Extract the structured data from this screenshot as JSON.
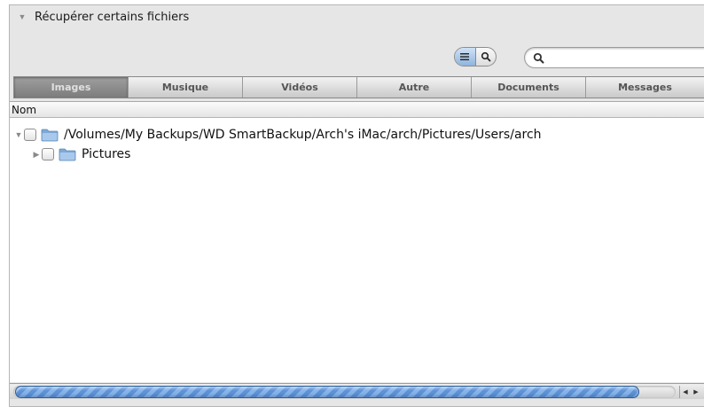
{
  "panel": {
    "title": "Récupérer certains fichiers"
  },
  "toolbar": {
    "view_buttons": [
      "list-view-icon",
      "search-icon"
    ],
    "search": {
      "value": "",
      "placeholder": ""
    }
  },
  "tabs": [
    {
      "label": "Images",
      "selected": true
    },
    {
      "label": "Musique",
      "selected": false
    },
    {
      "label": "Vidéos",
      "selected": false
    },
    {
      "label": "Autre",
      "selected": false
    },
    {
      "label": "Documents",
      "selected": false
    },
    {
      "label": "Messages",
      "selected": false
    }
  ],
  "list": {
    "column_header": "Nom",
    "rows": [
      {
        "label": "/Volumes/My Backups/WD SmartBackup/Arch's iMac/arch/Pictures/Users/arch",
        "expanded": true,
        "checked": false,
        "icon": "folder-icon"
      },
      {
        "label": "Pictures",
        "expanded": false,
        "checked": false,
        "icon": "folder-icon"
      }
    ]
  },
  "colors": {
    "selected_tab": "#8c8c8c",
    "folder": "#8fb6e0",
    "scroll_thumb": "#6d9fe0"
  }
}
